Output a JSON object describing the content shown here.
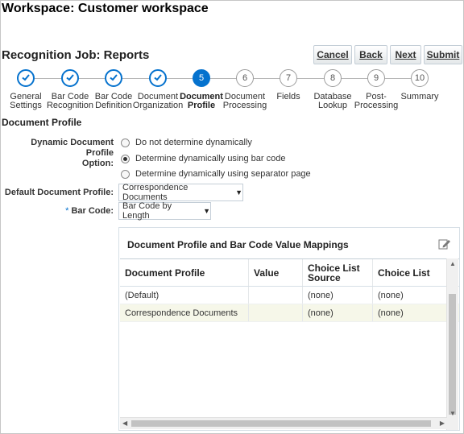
{
  "workspace_title": "Workspace: Customer workspace",
  "job_title": "Recognition Job: Reports",
  "buttons": {
    "cancel": "Cancel",
    "back": "Back",
    "next": "Next",
    "submit": "Submit"
  },
  "train": {
    "steps": [
      {
        "num": "1",
        "label": "General Settings",
        "state": "done"
      },
      {
        "num": "2",
        "label": "Bar Code Recognition",
        "state": "done"
      },
      {
        "num": "3",
        "label": "Bar Code Definition",
        "state": "done"
      },
      {
        "num": "4",
        "label": "Document Organization",
        "state": "done"
      },
      {
        "num": "5",
        "label": "Document Profile",
        "state": "current"
      },
      {
        "num": "6",
        "label": "Document Processing",
        "state": "todo"
      },
      {
        "num": "7",
        "label": "Fields",
        "state": "todo"
      },
      {
        "num": "8",
        "label": "Database Lookup",
        "state": "todo"
      },
      {
        "num": "9",
        "label": "Post-Processing",
        "state": "todo"
      },
      {
        "num": "10",
        "label": "Summary",
        "state": "todo"
      }
    ]
  },
  "section_title": "Document Profile",
  "dynamic_option": {
    "label_line1": "Dynamic Document Profile",
    "label_line2": "Option:",
    "options": [
      "Do not determine dynamically",
      "Determine dynamically using bar code",
      "Determine dynamically using separator page"
    ],
    "selected_index": 1
  },
  "default_profile": {
    "label": "Default Document Profile:",
    "value": "Correspondence Documents"
  },
  "bar_code": {
    "required_mark": "*",
    "label": "Bar Code:",
    "value": "Bar Code by Length"
  },
  "mappings": {
    "title": "Document Profile and Bar Code Value Mappings",
    "columns": [
      "Document Profile",
      "Value",
      "Choice List Source",
      "Choice List"
    ],
    "rows": [
      [
        "(Default)",
        "",
        "(none)",
        "(none)"
      ],
      [
        "Correspondence Documents",
        "",
        "(none)",
        "(none)"
      ]
    ]
  },
  "accent_color": "#0572ce",
  "icons": {
    "done": "checkmark-icon",
    "edit": "edit-pencil-icon",
    "dropdown": "chevron-down-icon"
  }
}
